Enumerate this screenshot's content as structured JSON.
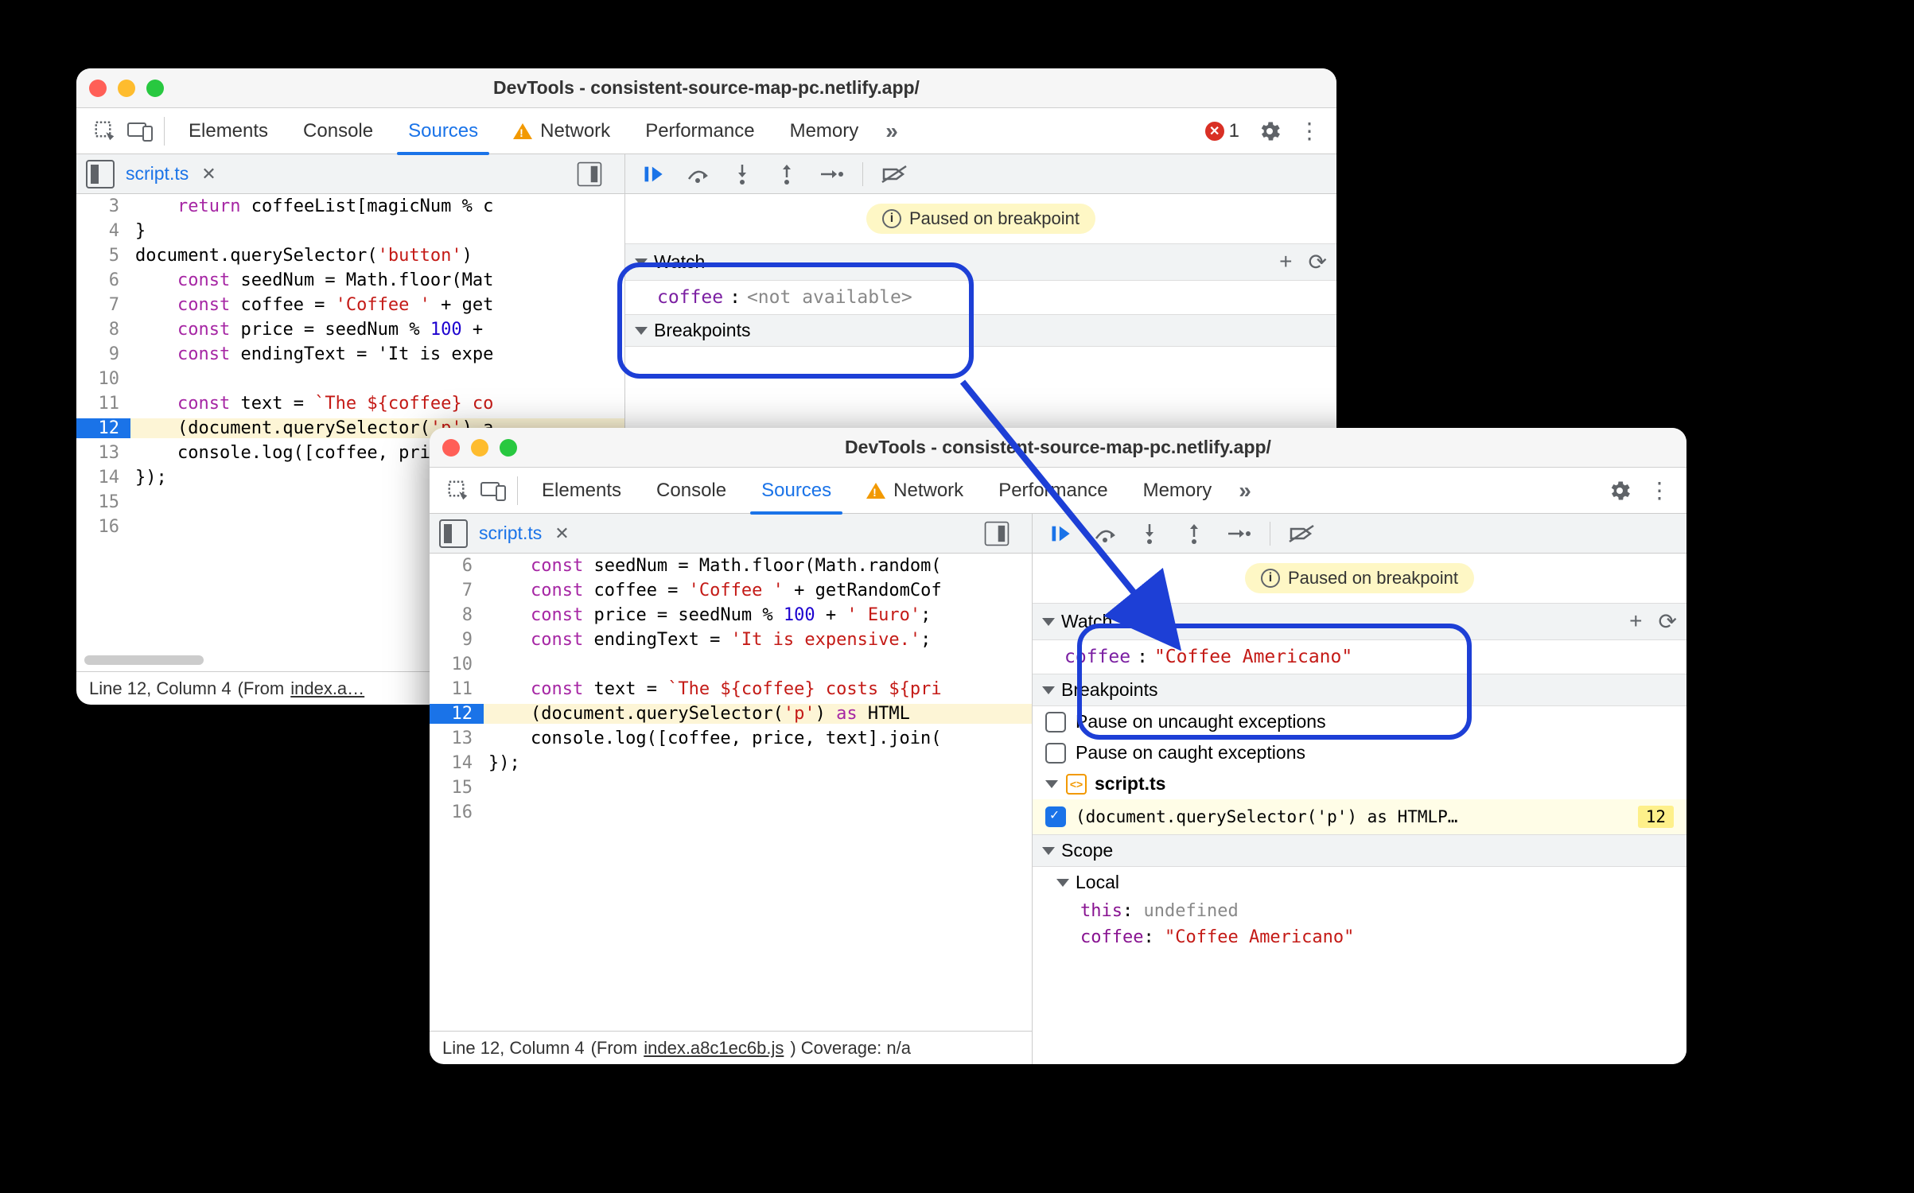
{
  "window1": {
    "title": "DevTools - consistent-source-map-pc.netlify.app/",
    "tabs": [
      "Elements",
      "Console",
      "Sources",
      "Network",
      "Performance",
      "Memory"
    ],
    "active_tab": "Sources",
    "error_count": "1",
    "file_tab": "script.ts",
    "lines": [
      {
        "n": "3",
        "txt": "    return coffeeList[magicNum % c"
      },
      {
        "n": "4",
        "txt": "}"
      },
      {
        "n": "5",
        "txt": "document.querySelector('button')"
      },
      {
        "n": "6",
        "txt": "    const seedNum = Math.floor(Mat"
      },
      {
        "n": "7",
        "txt": "    const coffee = 'Coffee ' + get"
      },
      {
        "n": "8",
        "txt": "    const price = seedNum % 100 + "
      },
      {
        "n": "9",
        "txt": "    const endingText = 'It is expe"
      },
      {
        "n": "10",
        "txt": ""
      },
      {
        "n": "11",
        "txt": "    const text = `The ${coffee} co"
      },
      {
        "n": "12",
        "txt": "    (document.querySelector('p') a",
        "hl": true
      },
      {
        "n": "13",
        "txt": "    console.log([coffee, price, te"
      },
      {
        "n": "14",
        "txt": "});"
      },
      {
        "n": "15",
        "txt": ""
      },
      {
        "n": "16",
        "txt": ""
      }
    ],
    "paused": "Paused on breakpoint",
    "watch_label": "Watch",
    "watch_var": "coffee",
    "watch_sep": ": ",
    "watch_val": "<not available>",
    "breakpoints_label": "Breakpoints",
    "status_a": "Line 12, Column 4",
    "status_b": "(From ",
    "status_c": "index.a…"
  },
  "window2": {
    "title": "DevTools - consistent-source-map-pc.netlify.app/",
    "tabs": [
      "Elements",
      "Console",
      "Sources",
      "Network",
      "Performance",
      "Memory"
    ],
    "active_tab": "Sources",
    "file_tab": "script.ts",
    "lines": [
      {
        "n": "6",
        "txt": "    const seedNum = Math.floor(Math.random("
      },
      {
        "n": "7",
        "txt": "    const coffee = 'Coffee ' + getRandomCof"
      },
      {
        "n": "8",
        "txt": "    const price = seedNum % 100 + ' Euro';"
      },
      {
        "n": "9",
        "txt": "    const endingText = 'It is expensive.';"
      },
      {
        "n": "10",
        "txt": ""
      },
      {
        "n": "11",
        "txt": "    const text = `The ${coffee} costs ${pri"
      },
      {
        "n": "12",
        "txt": "    (document.querySelector('p') as HTML",
        "hl": true
      },
      {
        "n": "13",
        "txt": "    console.log([coffee, price, text].join("
      },
      {
        "n": "14",
        "txt": "});"
      },
      {
        "n": "15",
        "txt": ""
      },
      {
        "n": "16",
        "txt": ""
      }
    ],
    "paused": "Paused on breakpoint",
    "watch_label": "Watch",
    "watch_var": "coffee",
    "watch_sep": ": ",
    "watch_val": "\"Coffee Americano\"",
    "breakpoints_label": "Breakpoints",
    "pause_uncaught": "Pause on uncaught exceptions",
    "pause_caught": "Pause on caught exceptions",
    "bp_file": "script.ts",
    "bp_text": "(document.querySelector('p') as HTMLP…",
    "bp_line": "12",
    "scope_label": "Scope",
    "local_label": "Local",
    "scope_this_k": "this",
    "scope_this_v": "undefined",
    "scope_coffee_k": "coffee",
    "scope_coffee_v": "\"Coffee Americano\"",
    "status_a": "Line 12, Column 4",
    "status_b": "(From ",
    "status_c": "index.a8c1ec6b.js",
    "status_d": ") Coverage: n/a"
  }
}
